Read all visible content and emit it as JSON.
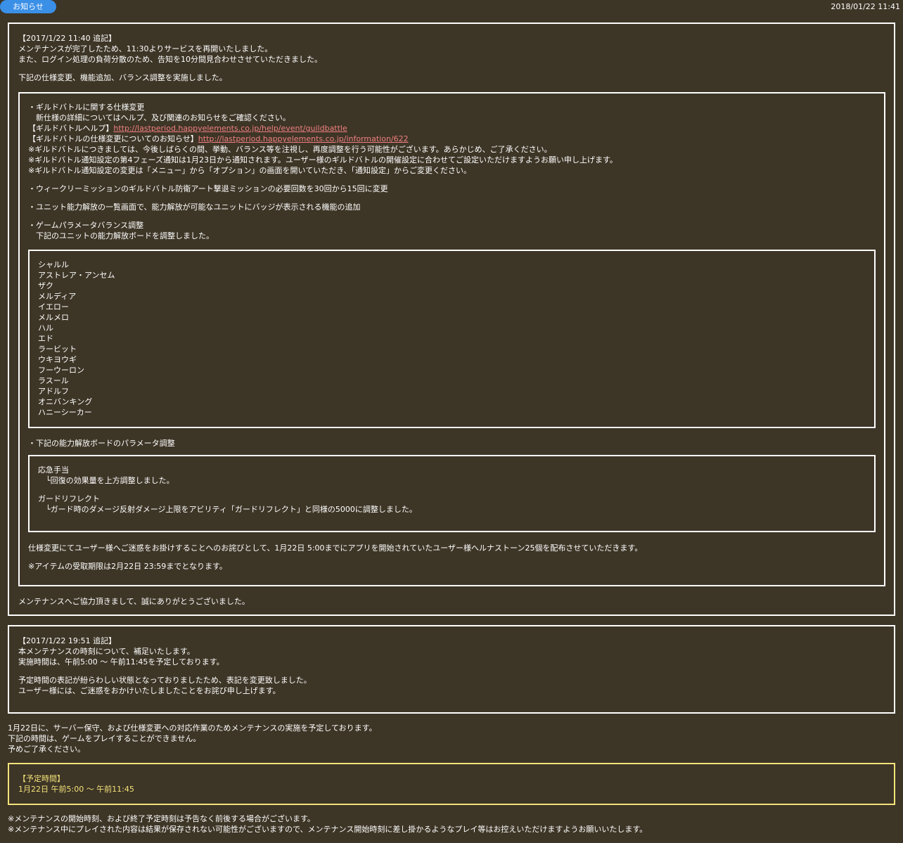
{
  "header": {
    "tag_label": "お知らせ",
    "date": "2018/01/22 11:41"
  },
  "update1": {
    "head": "【2017/1/22 11:40 追記】",
    "line1": "メンテナンスが完了したため、11:30よりサービスを再開いたしました。",
    "line2": "また、ログイン処理の負荷分散のため、告知を10分間見合わせさせていただきました。",
    "line3": "下記の仕様変更、機能追加、バランス調整を実施しました。",
    "inner": {
      "gb_title": "・ギルドバトルに関する仕様変更",
      "gb_detail": "　新仕様の詳細についてはヘルプ、及び関連のお知らせをご確認ください。",
      "help_label": "【ギルドバトルヘルプ】",
      "help_url": "http://lastperiod.happyelements.co.jp/help/event/guildbattle",
      "info_label": "【ギルドバトルの仕様変更についてのお知らせ】",
      "info_url": "http://lastperiod.happyelements.co.jp/information/622",
      "note1": "※ギルドバトルにつきましては、今後しばらくの間、挙動、バランス等を注視し、再度調整を行う可能性がございます。あらかじめ、ご了承ください。",
      "note2": "※ギルドバトル通知設定の第4フェーズ通知は1月23日から通知されます。ユーザー様のギルドバトルの開催設定に合わせてご設定いただけますようお願い申し上げます。",
      "note3": "※ギルドバトル通知設定の変更は「メニュー」から「オプション」の画面を開いていただき、「通知設定」からご変更ください。",
      "weekly": "・ウィークリーミッションのギルドバトル防衛アート撃退ミッションの必要回数を30回から15回に変更",
      "badge": "・ユニット能力解放の一覧画面で、能力解放が可能なユニットにバッジが表示される機能の追加",
      "balance_title": "・ゲームパラメータバランス調整",
      "balance_detail": "　下記のユニットの能力解放ボードを調整しました。",
      "units": [
        "シャルル",
        "アストレア・アンセム",
        "ザク",
        "メルディア",
        "イエロー",
        "メルメロ",
        "ハル",
        "エド",
        "ラービット",
        "ウキヨウギ",
        "フーウーロン",
        "ラスール",
        "アドルフ",
        "オニバンキング",
        "ハニーシーカー"
      ],
      "param_title": "・下記の能力解放ボードのパラメータ調整",
      "param1_name": "応急手当",
      "param1_detail": "　└回復の効果量を上方調整しました。",
      "param2_name": "ガードリフレクト",
      "param2_detail": "　└ガード時のダメージ反射ダメージ上限をアビリティ「ガードリフレクト」と同様の5000に調整しました。",
      "apology": "仕様変更にてユーザー様へご迷惑をお掛けすることへのお詫びとして、1月22日 5:00までにアプリを開始されていたユーザー様へルナストーン25個を配布させていただきます。",
      "deadline": "※アイテムの受取期限は2月22日 23:59までとなります。"
    },
    "thanks": "メンテナンスへご協力頂きまして、誠にありがとうございました。"
  },
  "update2": {
    "head": "【2017/1/22 19:51 追記】",
    "line1": "本メンテナンスの時刻について、補足いたします。",
    "line2": "実施時間は、午前5:00 ～ 午前11:45を予定しております。",
    "line3": "予定時間の表記が紛らわしい状態となっておりましたため、表記を変更致しました。",
    "line4": "ユーザー様には、ご迷惑をおかけいたしましたことをお詫び申し上げます。"
  },
  "main": {
    "line1": "1月22日に、サーバー保守、および仕様変更への対応作業のためメンテナンスの実施を予定しております。",
    "line2": "下記の時間は、ゲームをプレイすることができません。",
    "line3": "予めご了承ください。"
  },
  "schedule": {
    "label": "【予定時間】",
    "time": "1月22日 午前5:00 ～ 午前11:45"
  },
  "footer": {
    "note1": "※メンテナンスの開始時刻、および終了予定時刻は予告なく前後する場合がございます。",
    "note2": "※メンテナンス中にプレイされた内容は結果が保存されない可能性がございますので、メンテナンス開始時刻に差し掛かるようなプレイ等はお控えいただけますようお願いいたします。"
  }
}
